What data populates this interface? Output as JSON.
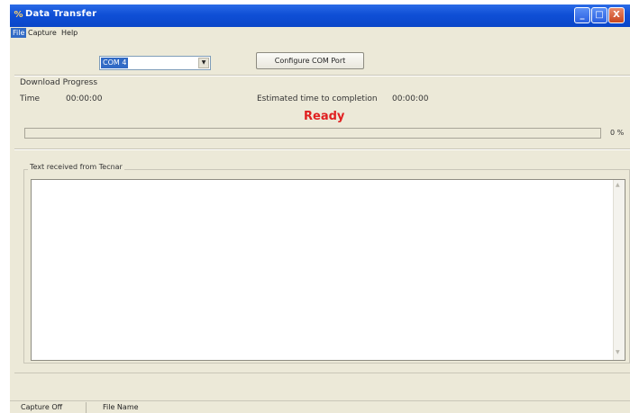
{
  "window": {
    "title": "Data Transfer",
    "app_icon": "%",
    "controls": {
      "minimize": "_",
      "maximize": "□",
      "close": "X"
    }
  },
  "menu": {
    "file": "File",
    "capture": "Capture",
    "help": "Help"
  },
  "port": {
    "selected": "COM 4",
    "dropdown_arrow": "▼",
    "configure_button": "Configure COM Port"
  },
  "download": {
    "section_label": "Download Progress",
    "time_label": "Time",
    "time_value": "00:00:00",
    "estimate_label": "Estimated time to completion",
    "estimate_value": "00:00:00",
    "status": "Ready",
    "status_color": "#e02020",
    "progress_fraction": 0,
    "progress_text": "0 %"
  },
  "received": {
    "group_label": "Text received from Tecnar",
    "content": ""
  },
  "statusbar": {
    "capture_state": "Capture Off",
    "file_name": "File Name"
  }
}
